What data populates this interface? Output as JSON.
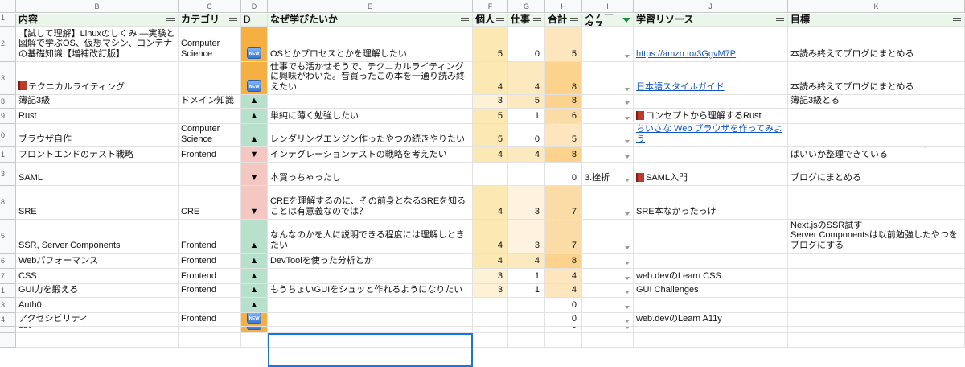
{
  "columns": [
    "B",
    "C",
    "D",
    "E",
    "F",
    "G",
    "H",
    "I",
    "J",
    "K"
  ],
  "headers": {
    "content": "内容",
    "category": "カテゴリ",
    "d": "D",
    "why": "なぜ学びたいか",
    "personal": "個人",
    "work": "仕事",
    "total": "合計",
    "status": "ステータス",
    "resource": "学習リソース",
    "goal": "目標"
  },
  "row_numbers": [
    "1",
    "2",
    "3",
    "8",
    "9",
    "0",
    "1",
    "3",
    "8",
    "5",
    "6",
    "7",
    "1",
    "3",
    "4",
    ""
  ],
  "rows": [
    {
      "content": "【試して理解】Linuxのしくみ ―実験と図解で学ぶOS、仮想マシン、コンテナの基礎知識【増補改訂版】",
      "category": "Computer Science",
      "mark": "new",
      "why": "OSとかプロセスとかを理解したい",
      "personal": "5",
      "work": "0",
      "total": "5",
      "status": "",
      "resource": "https://amzn.to/3GgvM7P",
      "resource_link": true,
      "resource_book": false,
      "goal": "本読み終えてブログにまとめる"
    },
    {
      "content": "テクニカルライティング",
      "content_book": true,
      "category": "",
      "mark": "new",
      "why": "仕事でも活かせそうで、テクニカルライティングに興味がわいた。昔買ったこの本を一通り読み終えたい",
      "personal": "4",
      "work": "4",
      "total": "8",
      "status": "",
      "resource": "日本語スタイルガイド",
      "resource_link": true,
      "resource_book": false,
      "goal": "本読み終えてブログにまとめる"
    },
    {
      "content": "簿記3級",
      "category": "ドメイン知識",
      "mark": "up",
      "why": "",
      "personal": "3",
      "work": "5",
      "total": "8",
      "status": "",
      "resource": "",
      "resource_link": false,
      "resource_book": false,
      "goal": "簿記3級とる"
    },
    {
      "content": "Rust",
      "category": "",
      "mark": "up",
      "why": "単純に薄く勉強したい",
      "personal": "5",
      "work": "1",
      "total": "6",
      "status": "",
      "resource": "コンセプトから理解するRust",
      "resource_link": false,
      "resource_book": true,
      "goal": ""
    },
    {
      "content": "ブラウザ自作",
      "category": "Computer Science",
      "mark": "up",
      "why": "レンダリングエンジン作ったやつの続きやりたい",
      "personal": "5",
      "work": "0",
      "total": "5",
      "status": "",
      "resource": "ちいさな Web ブラウザを作ってみよう",
      "resource_link": true,
      "resource_book": false,
      "goal": ""
    },
    {
      "content": "フロントエンドのテスト戦略",
      "category": "Frontend",
      "mark": "down",
      "why": "インテグレーションテストの戦略を考えたい",
      "personal": "4",
      "work": "4",
      "total": "8",
      "status": "",
      "resource": "",
      "resource_link": false,
      "resource_book": false,
      "goal": "・今のログラスでどういうテスト書いてけばいいか整理できている"
    },
    {
      "content": "SAML",
      "category": "",
      "mark": "down",
      "why": "本買っちゃったし",
      "personal": "",
      "work": "",
      "total": "0",
      "status": "3.挫折",
      "resource": "SAML入門",
      "resource_link": false,
      "resource_book": true,
      "goal": "ブログにまとめる"
    },
    {
      "content": "SRE",
      "category": "CRE",
      "mark": "down",
      "why": "CREを理解するのに、その前身となるSREを知ることは有意義なのでは？",
      "personal": "4",
      "work": "3",
      "total": "7",
      "status": "",
      "resource": "SRE本なかったっけ",
      "resource_link": false,
      "resource_book": false,
      "goal": ""
    },
    {
      "content": "SSR, Server Components",
      "category": "Frontend",
      "mark": "up",
      "why": "なんなのかを人に説明できる程度には理解しときたい",
      "personal": "4",
      "work": "3",
      "total": "7",
      "status": "",
      "resource": "",
      "resource_link": false,
      "resource_book": false,
      "goal": "なむさんの記事読んで自分もSSR実装する\nNext.jsのSSR試す\nServer Componentsは以前勉強したやつをブログにする"
    },
    {
      "content": "Webパフォーマンス",
      "category": "Frontend",
      "mark": "up",
      "why": "とりあえずフロントエンド限定。\nパフォーマンスを継続的に測定するしくみとか、DevToolを使った分析とか",
      "personal": "4",
      "work": "4",
      "total": "8",
      "status": "",
      "resource": "",
      "resource_link": false,
      "resource_book": false,
      "goal": ""
    },
    {
      "content": "CSS",
      "category": "Frontend",
      "mark": "up",
      "why": "",
      "personal": "3",
      "work": "1",
      "total": "4",
      "status": "",
      "resource": "web.devのLearn CSS",
      "resource_link": false,
      "resource_book": false,
      "goal": ""
    },
    {
      "content": "GUI力を鍛える",
      "category": "Frontend",
      "mark": "up",
      "why": "もうちょいGUIをシュッと作れるようになりたい",
      "personal": "3",
      "work": "1",
      "total": "4",
      "status": "",
      "resource": "GUI Challenges",
      "resource_link": false,
      "resource_book": false,
      "goal": ""
    },
    {
      "content": "Auth0",
      "category": "",
      "mark": "up",
      "why": "",
      "personal": "",
      "work": "",
      "total": "0",
      "status": "",
      "resource": "",
      "resource_link": false,
      "resource_book": false,
      "goal": ""
    },
    {
      "content": "アクセシビリティ",
      "category": "Frontend",
      "mark": "new",
      "why": "",
      "personal": "",
      "work": "",
      "total": "0",
      "status": "",
      "resource": "web.devのLearn A11y",
      "resource_link": false,
      "resource_book": false,
      "goal": ""
    },
    {
      "content": "dbt",
      "category": "",
      "mark": "new",
      "why": "",
      "personal": "",
      "work": "",
      "total": "0",
      "status": "",
      "resource": "",
      "resource_link": false,
      "resource_book": false,
      "goal": ""
    },
    {
      "content": "",
      "category": "",
      "mark": "",
      "why": "",
      "personal": "",
      "work": "",
      "total": "",
      "status": "",
      "resource": "",
      "resource_link": false,
      "resource_book": false,
      "goal": ""
    }
  ],
  "new_badge_text": "NEW",
  "up_glyph": "▲",
  "down_glyph": "▼",
  "colors": {
    "header_bg": "#eaf6ea",
    "mark_new": "#f5b041",
    "mark_up": "#b7e1cd",
    "mark_down": "#f4c7c3",
    "personal_heat": "#fce8b2",
    "total_heat": "#fbd38d",
    "link": "#1155cc"
  }
}
